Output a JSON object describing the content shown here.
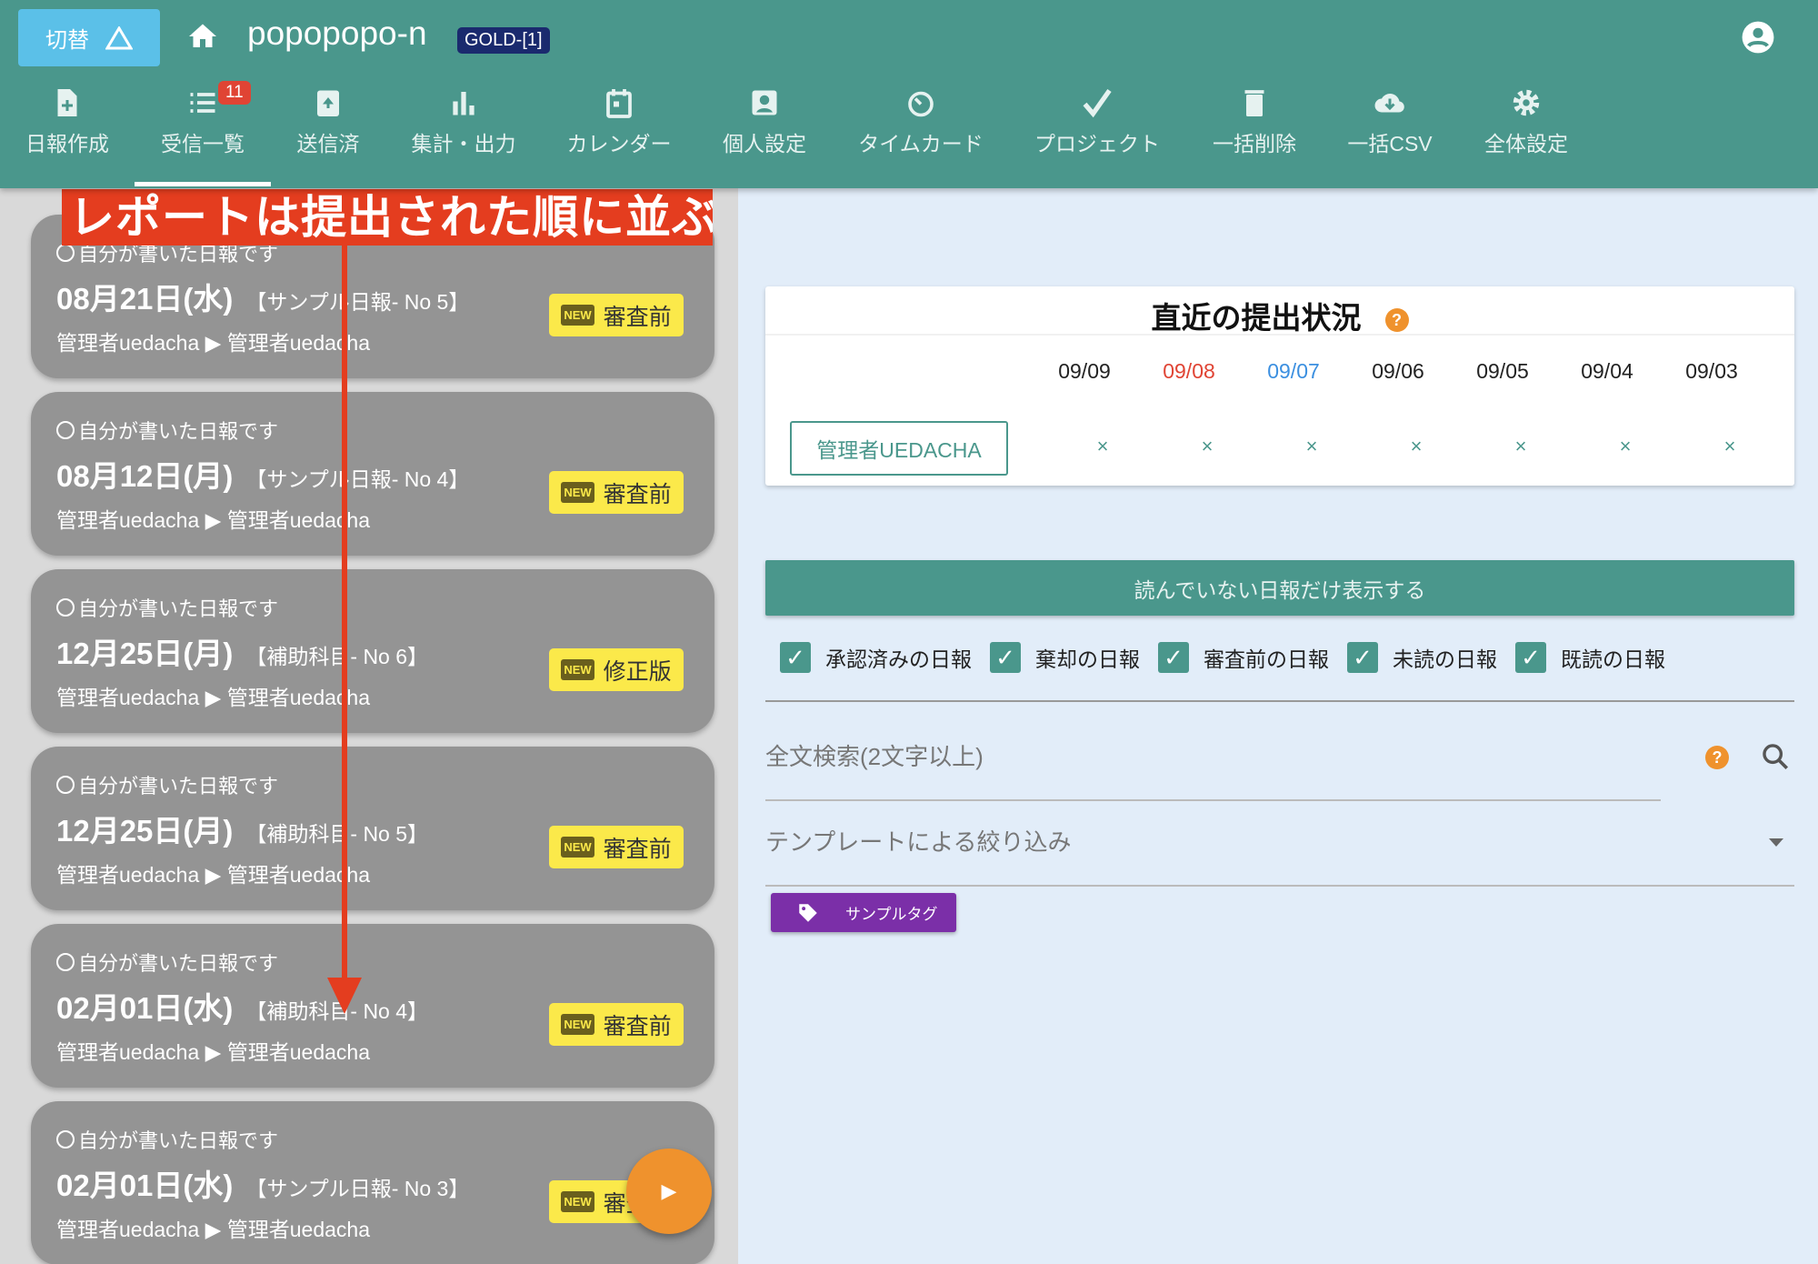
{
  "header": {
    "switch_label": "切替",
    "app_name": "popopopo-n",
    "plan_badge": "GOLD-[1]"
  },
  "nav": [
    {
      "label": "日報作成",
      "icon": "file-plus-icon"
    },
    {
      "label": "受信一覧",
      "icon": "list-icon",
      "badge": "11",
      "active": true
    },
    {
      "label": "送信済",
      "icon": "upload-box-icon"
    },
    {
      "label": "集計・出力",
      "icon": "bar-chart-icon"
    },
    {
      "label": "カレンダー",
      "icon": "calendar-icon"
    },
    {
      "label": "個人設定",
      "icon": "person-icon"
    },
    {
      "label": "タイムカード",
      "icon": "timer-icon"
    },
    {
      "label": "プロジェクト",
      "icon": "check-icon"
    },
    {
      "label": "一括削除",
      "icon": "trash-icon"
    },
    {
      "label": "一括CSV",
      "icon": "cloud-download-icon"
    },
    {
      "label": "全体設定",
      "icon": "gear-icon"
    }
  ],
  "annotation": "レポートは提出された順に並ぶ",
  "reports": [
    {
      "own": "自分が書いた日報です",
      "date": "08月21日(水)",
      "template": "【サンプル日報- No 5】",
      "from": "管理者uedacha",
      "to": "管理者uedacha",
      "status": "審査前"
    },
    {
      "own": "自分が書いた日報です",
      "date": "08月12日(月)",
      "template": "【サンプル日報- No 4】",
      "from": "管理者uedacha",
      "to": "管理者uedacha",
      "status": "審査前"
    },
    {
      "own": "自分が書いた日報です",
      "date": "12月25日(月)",
      "template": "【補助科目- No 6】",
      "from": "管理者uedacha",
      "to": "管理者uedacha",
      "status": "修正版"
    },
    {
      "own": "自分が書いた日報です",
      "date": "12月25日(月)",
      "template": "【補助科目- No 5】",
      "from": "管理者uedacha",
      "to": "管理者uedacha",
      "status": "審査前"
    },
    {
      "own": "自分が書いた日報です",
      "date": "02月01日(水)",
      "template": "【補助科目- No 4】",
      "from": "管理者uedacha",
      "to": "管理者uedacha",
      "status": "審査前"
    },
    {
      "own": "自分が書いた日報です",
      "date": "02月01日(水)",
      "template": "【サンプル日報- No 3】",
      "from": "管理者uedacha",
      "to": "管理者uedacha",
      "status": "審査前"
    }
  ],
  "new_label": "NEW",
  "submission": {
    "title": "直近の提出状況",
    "help": "?",
    "dates": [
      {
        "label": "09/09",
        "color": "#222222"
      },
      {
        "label": "09/08",
        "color": "#e04434"
      },
      {
        "label": "09/07",
        "color": "#3b8fe0"
      },
      {
        "label": "09/06",
        "color": "#222222"
      },
      {
        "label": "09/05",
        "color": "#222222"
      },
      {
        "label": "09/04",
        "color": "#222222"
      },
      {
        "label": "09/03",
        "color": "#222222"
      }
    ],
    "user": "管理者UEDACHA",
    "marks": [
      "×",
      "×",
      "×",
      "×",
      "×",
      "×",
      "×"
    ]
  },
  "filters": {
    "unread_button": "読んでいない日報だけ表示する",
    "checkboxes": [
      {
        "label": "承認済みの日報",
        "checked": true
      },
      {
        "label": "棄却の日報",
        "checked": true
      },
      {
        "label": "審査前の日報",
        "checked": true
      },
      {
        "label": "未読の日報",
        "checked": true
      },
      {
        "label": "既読の日報",
        "checked": true
      }
    ],
    "search_placeholder": "全文検索(2文字以上)",
    "template_placeholder": "テンプレートによる絞り込み",
    "tag": "サンプルタグ"
  }
}
